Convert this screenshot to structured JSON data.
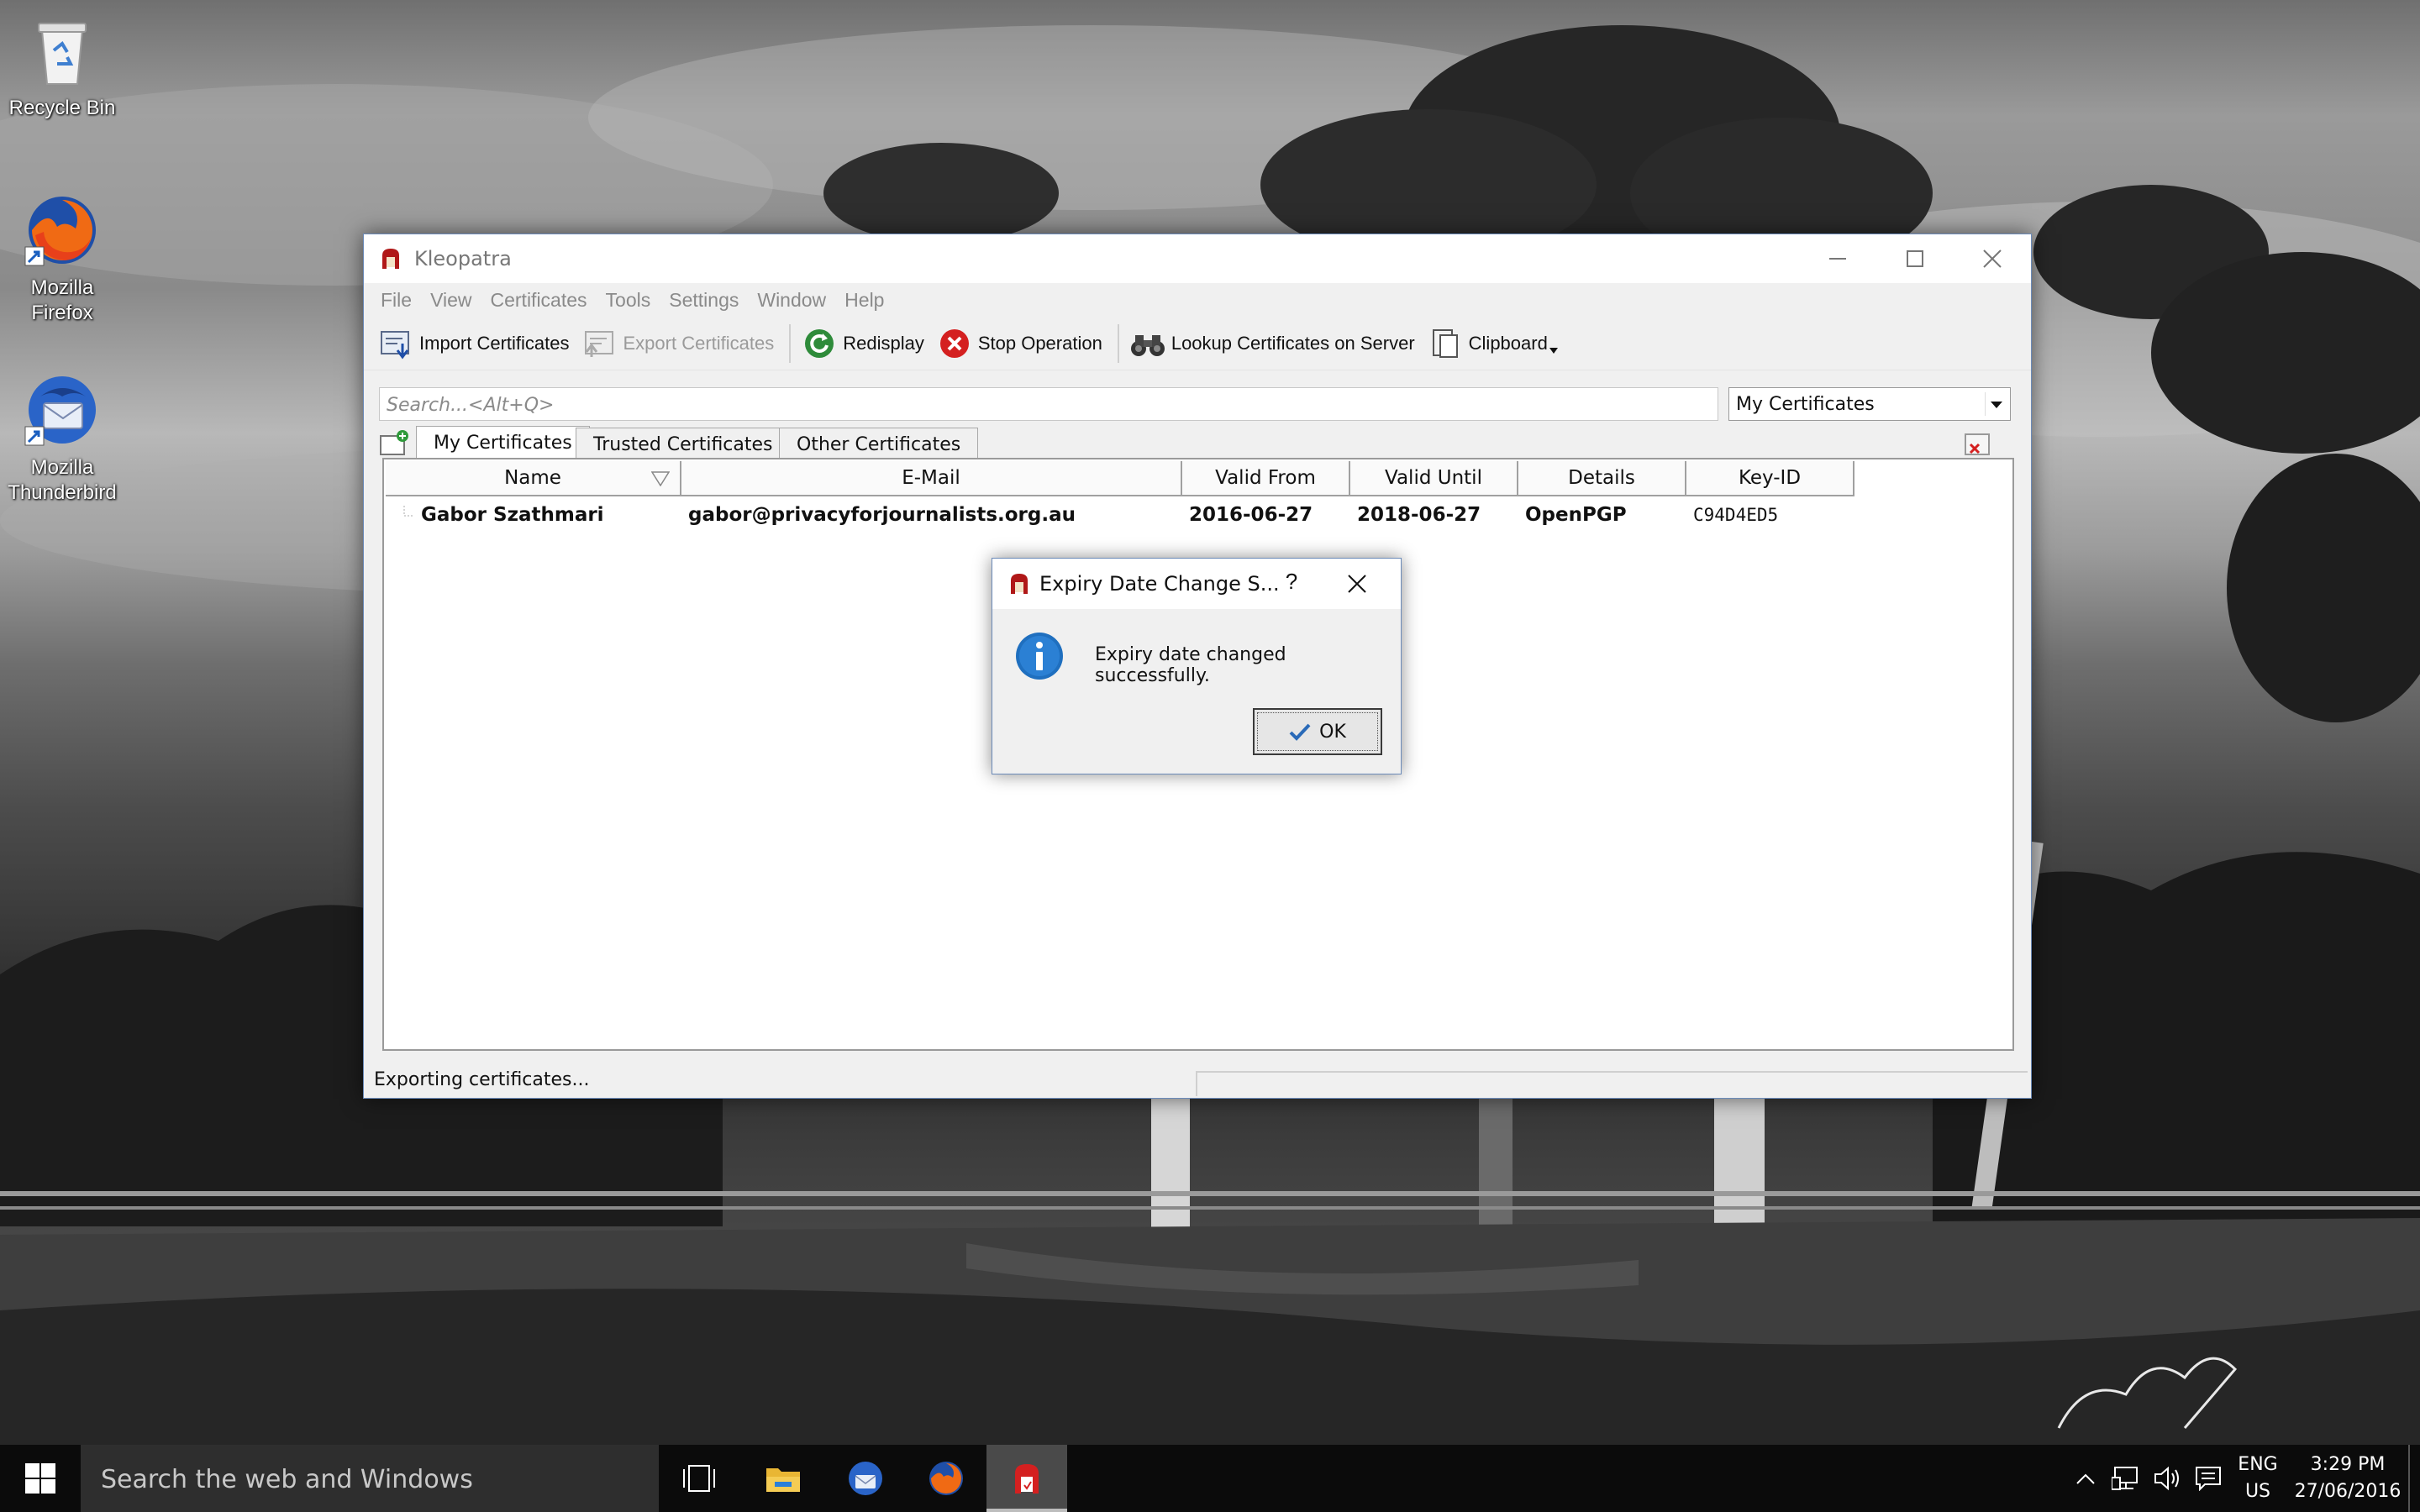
{
  "desktop": {
    "icons": [
      {
        "label": "Recycle Bin"
      },
      {
        "label": "Mozilla Firefox"
      },
      {
        "label": "Mozilla Thunderbird"
      }
    ]
  },
  "window": {
    "title": "Kleopatra",
    "menu": [
      "File",
      "View",
      "Certificates",
      "Tools",
      "Settings",
      "Window",
      "Help"
    ],
    "toolbar": {
      "import": "Import Certificates",
      "export": "Export Certificates",
      "redisplay": "Redisplay",
      "stop": "Stop Operation",
      "lookup": "Lookup Certificates on Server",
      "clipboard": "Clipboard"
    },
    "search": {
      "placeholder": "Search...<Alt+Q>",
      "value": ""
    },
    "filter": {
      "selected": "My Certificates"
    },
    "tabs": [
      "My Certificates",
      "Trusted Certificates",
      "Other Certificates"
    ],
    "columns": [
      "Name",
      "E-Mail",
      "Valid From",
      "Valid Until",
      "Details",
      "Key-ID"
    ],
    "rows": [
      {
        "name": "Gabor Szathmari",
        "email": "gabor@privacyforjournalists.org.au",
        "valid_from": "2016-06-27",
        "valid_until": "2018-06-27",
        "details": "OpenPGP",
        "key_id": "C94D4ED5"
      }
    ],
    "status": "Exporting certificates..."
  },
  "dialog": {
    "title": "Expiry Date Change S...",
    "help": "?",
    "message": "Expiry date changed successfully.",
    "ok": "OK"
  },
  "taskbar": {
    "search_placeholder": "Search the web and Windows",
    "lang_line1": "ENG",
    "lang_line2": "US",
    "time": "3:29 PM",
    "date": "27/06/2016"
  },
  "colors": {
    "window_border": "#6b8ab8",
    "taskbar": "#0b0b0b",
    "kleopatra_red": "#b01818",
    "info_blue": "#1f6fbf"
  }
}
